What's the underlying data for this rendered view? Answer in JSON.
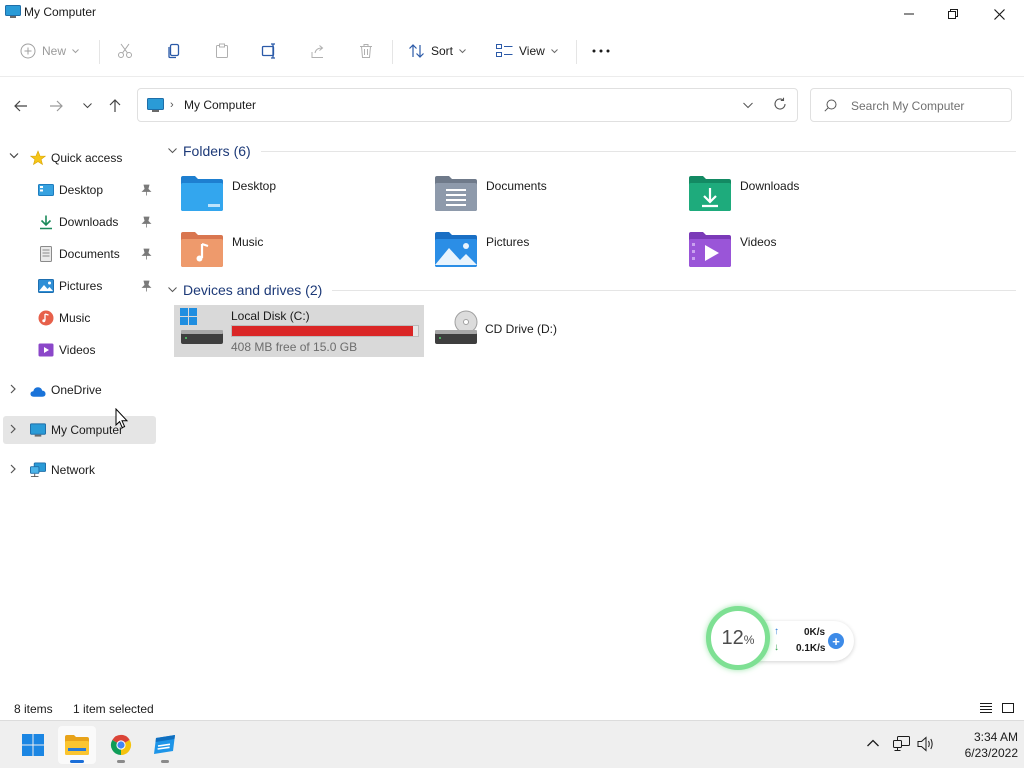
{
  "window": {
    "title": "My Computer"
  },
  "toolbar": {
    "new_label": "New",
    "sort_label": "Sort",
    "view_label": "View",
    "more_label": "···"
  },
  "address": {
    "path": "My Computer",
    "search_placeholder": "Search My Computer"
  },
  "sidebar": {
    "quick_access": "Quick access",
    "items": [
      {
        "label": "Desktop",
        "pinned": true
      },
      {
        "label": "Downloads",
        "pinned": true
      },
      {
        "label": "Documents",
        "pinned": true
      },
      {
        "label": "Pictures",
        "pinned": true
      },
      {
        "label": "Music",
        "pinned": false
      },
      {
        "label": "Videos",
        "pinned": false
      }
    ],
    "onedrive": "OneDrive",
    "my_computer": "My Computer",
    "network": "Network"
  },
  "folders": {
    "header": "Folders (6)",
    "items": [
      {
        "name": "Desktop"
      },
      {
        "name": "Documents"
      },
      {
        "name": "Downloads"
      },
      {
        "name": "Music"
      },
      {
        "name": "Pictures"
      },
      {
        "name": "Videos"
      }
    ]
  },
  "drives": {
    "header": "Devices and drives (2)",
    "items": [
      {
        "name": "Local Disk (C:)",
        "free_text": "408 MB free of 15.0 GB",
        "used_fraction": 0.973
      },
      {
        "name": "CD Drive (D:)"
      }
    ]
  },
  "widget": {
    "cpu_percent": "12",
    "percent_sign": "%",
    "upload": "0K/s",
    "download": "0.1K/s",
    "up_arrow": "↑",
    "down_arrow": "↓",
    "plus": "+"
  },
  "status": {
    "item_count": "8 items",
    "selection": "1 item selected"
  },
  "taskbar": {
    "time": "3:34 AM",
    "date": "6/23/2022"
  },
  "colors": {
    "accent": "#1a6ed8",
    "disk_fill": "#da2626",
    "header_text": "#1d3a78",
    "widget_ring": "#7ee093"
  }
}
